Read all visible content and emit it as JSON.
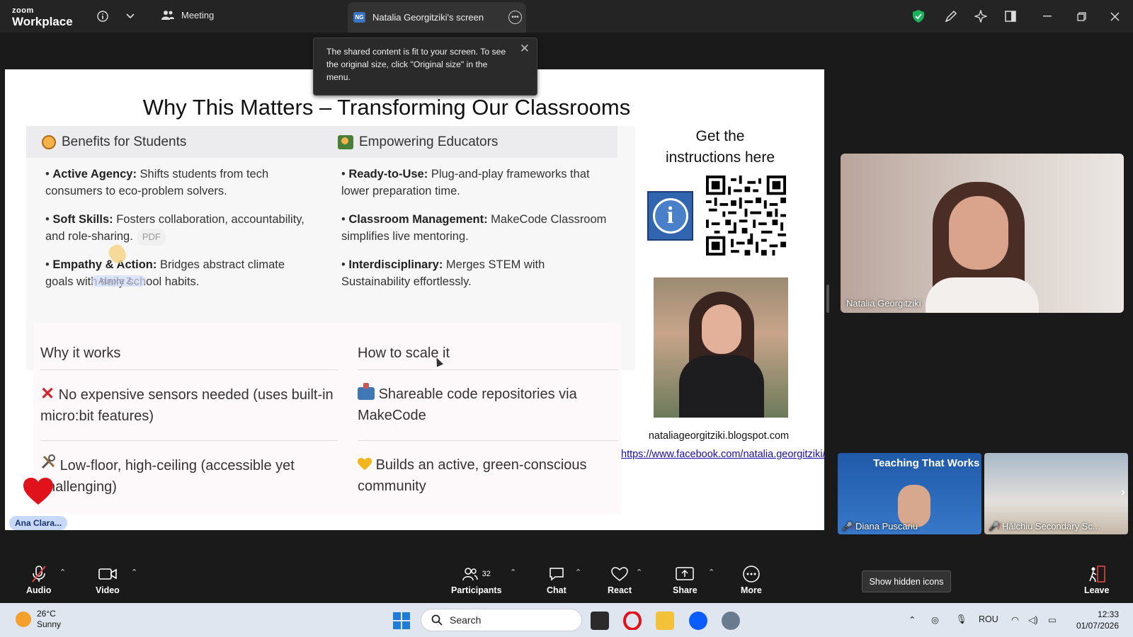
{
  "topbar": {
    "brand_small": "zoom",
    "brand_large": "Workplace",
    "meeting_label": "Meeting",
    "screen_tab_badge": "NG",
    "screen_tab_label": "Natalia Georgitziki's screen"
  },
  "tooltip": {
    "text": "The shared content is fit to your screen. To see the original size, click \"Original size\" in the menu."
  },
  "slide": {
    "title": "Why This Matters – Transforming Our Classrooms",
    "benefits_header": "Benefits for Students",
    "educators_header": "Empowering Educators",
    "benefits": [
      {
        "term": "Active Agency:",
        "text": " Shifts students from tech consumers to eco-problem solvers."
      },
      {
        "term": "Soft Skills:",
        "text": " Fosters collaboration, accountability, and role-sharing."
      },
      {
        "term": "Empathy & Action:",
        "text": " Bridges abstract climate goals with daily school habits."
      }
    ],
    "educators": [
      {
        "term": "Ready-to-Use:",
        "text": " Plug-and-play frameworks that lower preparation time."
      },
      {
        "term": "Classroom Management:",
        "text": " MakeCode Classroom simplifies live mentoring."
      },
      {
        "term": "Interdisciplinary:",
        "text": " Merges STEM with Sustainability effortlessly."
      }
    ],
    "pdf_tag": "PDF",
    "ghost_name": "Aurora Z...",
    "why_header": "Why it works",
    "scale_header": "How to scale it",
    "why_items": [
      "No expensive sensors needed (uses built-in micro:bit features)",
      "Low-floor, high-ceiling (accessible yet challenging)"
    ],
    "scale_items": [
      "Shareable code repositories via MakeCode",
      "Builds an active, green-conscious community"
    ],
    "instructions": "Get the instructions here",
    "blog": "nataliageorgitziki.blogspot.com",
    "facebook": "https://www.facebook.com/natalia.georgitziki/",
    "annotation_tag": "Ana Clara..."
  },
  "videos": {
    "main_name": "Natalia Georgitziki",
    "thumb1_title": "Teaching That Works",
    "thumb1_name": "Diana Puscariu",
    "thumb2_name": "Hălchiu Secondary Sc..."
  },
  "controls": {
    "audio": "Audio",
    "video": "Video",
    "participants": "Participants",
    "participants_count": "32",
    "chat": "Chat",
    "react": "React",
    "share": "Share",
    "more": "More",
    "leave": "Leave",
    "show_hidden": "Show hidden icons"
  },
  "taskbar": {
    "temperature": "26°C",
    "condition": "Sunny",
    "search": "Search",
    "language": "ROU",
    "time": "12:33",
    "date": "01/07/2026"
  },
  "colors": {
    "zoom_blue": "#0b5cff",
    "link": "#1a0dab",
    "leave_red": "#e24545",
    "shield_green": "#19b35a"
  }
}
